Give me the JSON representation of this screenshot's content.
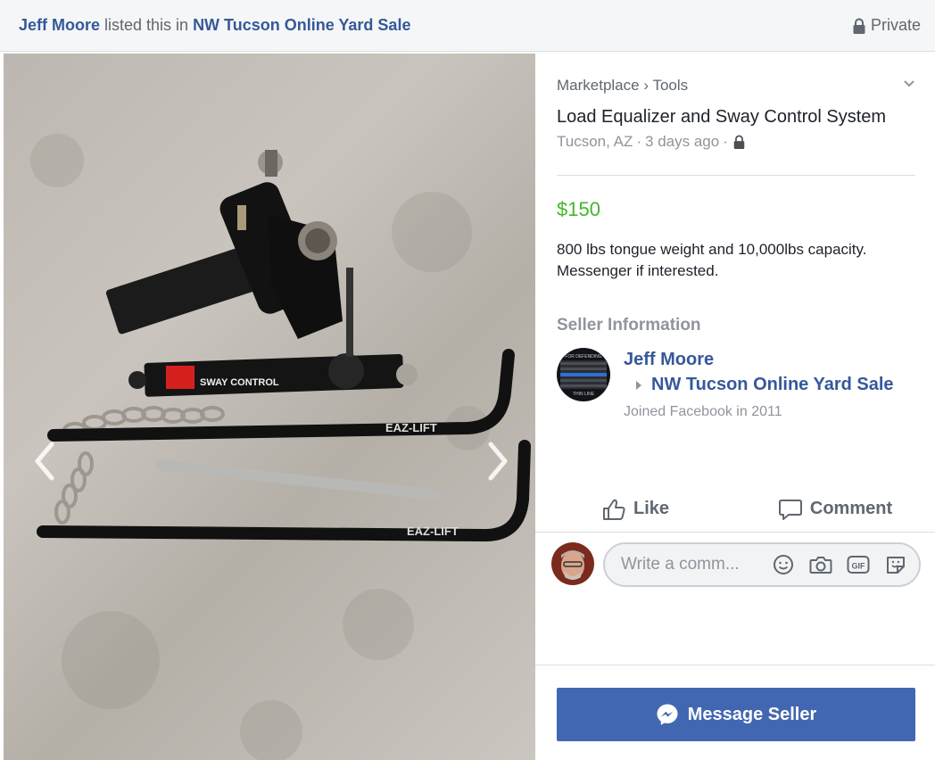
{
  "header": {
    "poster": "Jeff Moore",
    "listed_text": " listed this in ",
    "group": "NW Tucson Online Yard Sale",
    "privacy": "Private"
  },
  "photo": {
    "image_count": 3,
    "active_index": 0,
    "printed_text": [
      "SWAY CONTROL",
      "EAZ-LIFT",
      "EAZ-LIFT"
    ]
  },
  "listing": {
    "breadcrumb_root": "Marketplace",
    "breadcrumb_sep": "›",
    "breadcrumb_category": "Tools",
    "title": "Load Equalizer and Sway Control System",
    "location": "Tucson, AZ",
    "time": "3 days ago",
    "meta_sep": "·",
    "price": "$150",
    "description_line1": "800 lbs tongue weight and 10,000lbs capacity.",
    "description_line2": "Messenger if interested."
  },
  "seller": {
    "heading": "Seller Information",
    "name": "Jeff Moore",
    "group": "NW Tucson Online Yard Sale",
    "joined": "Joined Facebook in 2011",
    "avatar_text_top": "FOR DEFENDING",
    "avatar_text_bottom": "THIN LINE"
  },
  "actions": {
    "like": "Like",
    "comment": "Comment"
  },
  "comment": {
    "placeholder": "Write a comm..."
  },
  "cta": {
    "message_seller": "Message Seller"
  },
  "colors": {
    "link": "#365899",
    "price": "#42b72a",
    "button": "#4267b2",
    "muted": "#90949c"
  }
}
